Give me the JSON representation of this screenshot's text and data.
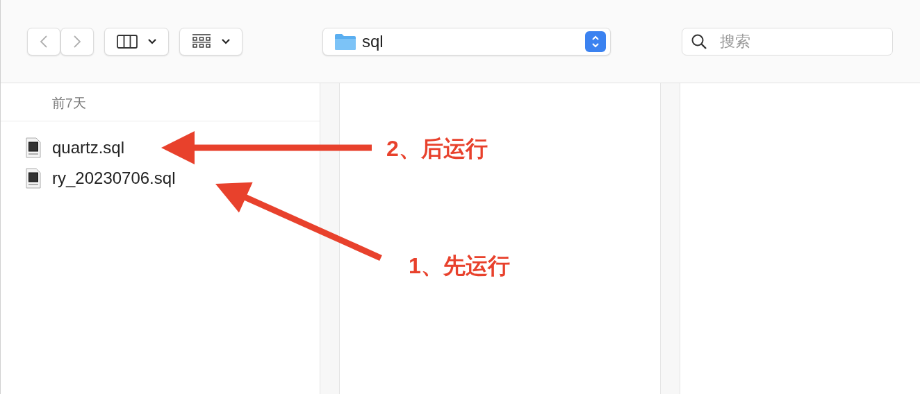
{
  "toolbar": {
    "path_popup": {
      "label": "sql"
    },
    "search": {
      "placeholder": "搜索"
    }
  },
  "browser": {
    "section": "前7天",
    "files": [
      {
        "name": "quartz.sql"
      },
      {
        "name": "ry_20230706.sql"
      }
    ]
  },
  "annotations": [
    {
      "label": "2、后运行"
    },
    {
      "label": "1、先运行"
    }
  ]
}
